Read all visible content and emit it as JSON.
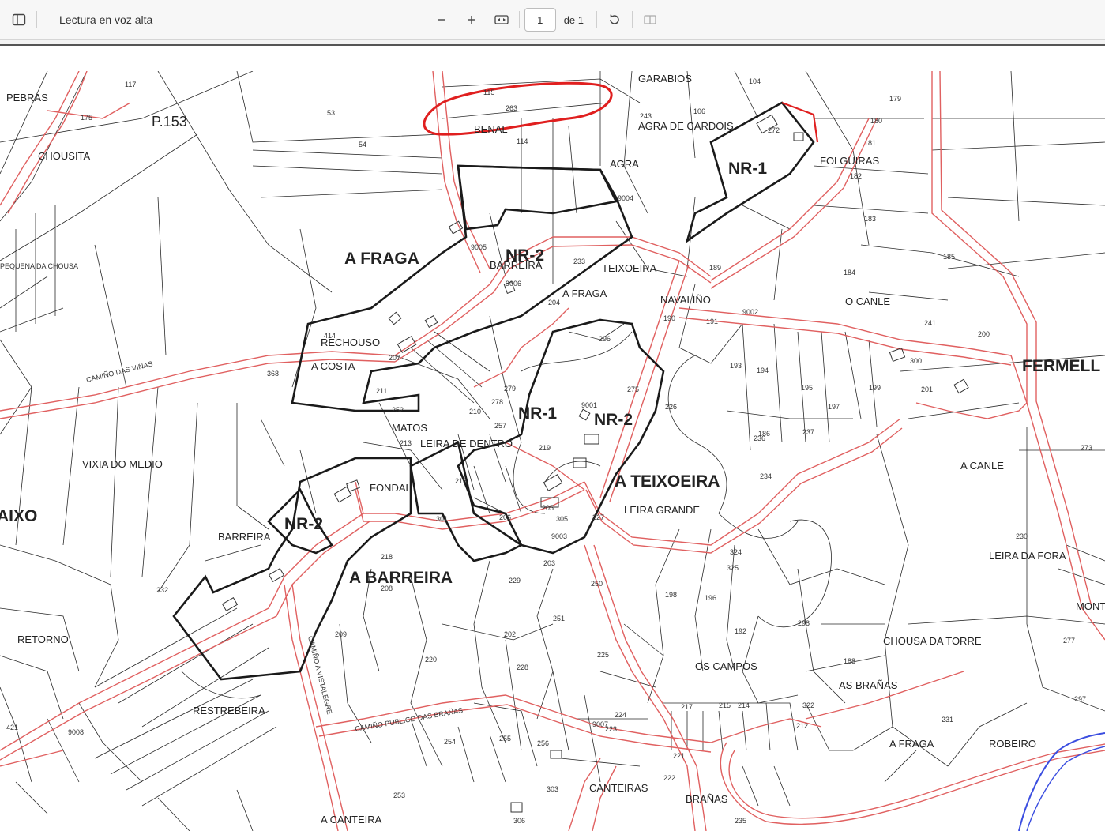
{
  "toolbar": {
    "read_aloud": "Lectura en voz alta",
    "page_value": "1",
    "page_total": "de 1"
  },
  "map": {
    "sheet": "P.153",
    "zones": [
      "A FRAGA",
      "NR-2",
      "NR-1",
      "NR-2",
      "A TEIXOEIRA",
      "NR-2",
      "A BARREIRA",
      "NR-1",
      "FERMELL",
      "AIXO"
    ],
    "places": [
      "PEBRAS",
      "CHOUSITA",
      "GARABIOS",
      "AGRA DE CARDOIS",
      "BENAL",
      "AGRA",
      "FOLGUIRAS",
      "BARREIRA",
      "TEIXOEIRA",
      "A FRAGA",
      "NAVALIÑO",
      "O CANLE",
      "RECHOUSO",
      "A COSTA",
      "MATOS",
      "LEIRA DE DENTRO",
      "VIXIA DO MEDIO",
      "FONDAL",
      "LEIRA GRANDE",
      "A CANLE",
      "BARREIRA",
      "LEIRA DA FORA",
      "RETORNO",
      "CHOUSA DA TORRE",
      "OS CAMPOS",
      "AS BRAÑAS",
      "RESTREBEIRA",
      "A FRAGA",
      "ROBEIRO",
      "CANTEIRAS",
      "BRAÑAS",
      "A CANTEIRA",
      "MONT",
      "PEQUENA DA CHOUSA",
      "CAMIÑO DAS VIÑAS",
      "CAMIÑO PUBLICO DAS BRAÑAS",
      "CAMIÑO A VISTALEGRE"
    ],
    "parcel_numbers": [
      "175",
      "117",
      "53",
      "54",
      "115",
      "263",
      "114",
      "243",
      "106",
      "104",
      "179",
      "180",
      "181",
      "182",
      "183",
      "184",
      "185",
      "186",
      "188",
      "189",
      "190",
      "191",
      "192",
      "193",
      "194",
      "195",
      "196",
      "197",
      "198",
      "199",
      "200",
      "201",
      "202",
      "203",
      "204",
      "205",
      "206",
      "207",
      "208",
      "209",
      "210",
      "211",
      "212",
      "213",
      "214",
      "215",
      "216",
      "217",
      "218",
      "219",
      "220",
      "221",
      "222",
      "223",
      "224",
      "225",
      "226",
      "227",
      "228",
      "229",
      "230",
      "231",
      "232",
      "233",
      "234",
      "235",
      "236",
      "237",
      "241",
      "250",
      "251",
      "252",
      "253",
      "254",
      "255",
      "256",
      "257",
      "272",
      "273",
      "275",
      "277",
      "278",
      "279",
      "296",
      "297",
      "298",
      "300",
      "301",
      "303",
      "305",
      "306",
      "322",
      "324",
      "325",
      "368",
      "414",
      "421",
      "9001",
      "9002",
      "9003",
      "9004",
      "9005",
      "9006",
      "9007",
      "9008"
    ],
    "colors": {
      "road": "#e06060",
      "boundary": "#222222",
      "highlight": "#e01f1f",
      "river": "#3a4de0"
    }
  }
}
